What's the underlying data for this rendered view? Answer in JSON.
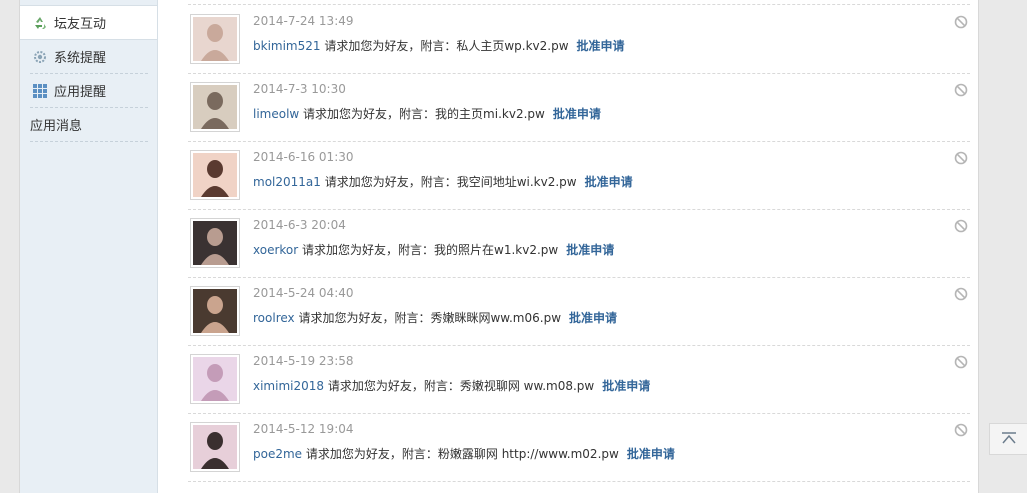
{
  "sidebar": {
    "items": [
      {
        "label": "坛友互动",
        "icon": "recycle-icon"
      },
      {
        "label": "系统提醒",
        "icon": "gear-icon"
      },
      {
        "label": "应用提醒",
        "icon": "grid-icon"
      },
      {
        "label": "应用消息",
        "icon": ""
      }
    ]
  },
  "notices": [
    {
      "time": "2014-7-24 13:49",
      "user": "bkimim521",
      "text": " 请求加您为好友，附言：私人主页wp.kv2.pw",
      "approve": "批准申请"
    },
    {
      "time": "2014-7-3 10:30",
      "user": "limeolw",
      "text": " 请求加您为好友，附言：我的主页mi.kv2.pw",
      "approve": "批准申请"
    },
    {
      "time": "2014-6-16 01:30",
      "user": "mol2011a1",
      "text": " 请求加您为好友，附言：我空间地址wi.kv2.pw",
      "approve": "批准申请"
    },
    {
      "time": "2014-6-3 20:04",
      "user": "xoerkor",
      "text": " 请求加您为好友，附言：我的照片在w1.kv2.pw",
      "approve": "批准申请"
    },
    {
      "time": "2014-5-24 04:40",
      "user": "roolrex",
      "text": " 请求加您为好友，附言：秀嫩眯眯网ww.m06.pw",
      "approve": "批准申请"
    },
    {
      "time": "2014-5-19 23:58",
      "user": "ximimi2018",
      "text": " 请求加您为好友，附言：秀嫩视聊网 ww.m08.pw",
      "approve": "批准申请"
    },
    {
      "time": "2014-5-12 19:04",
      "user": "poe2me",
      "text": " 请求加您为好友，附言：粉嫩露聊网 http://www.m02.pw",
      "approve": "批准申请"
    }
  ],
  "colors": {
    "link": "#336699",
    "time": "#999999",
    "sidebar_bg": "#e8eff5"
  }
}
